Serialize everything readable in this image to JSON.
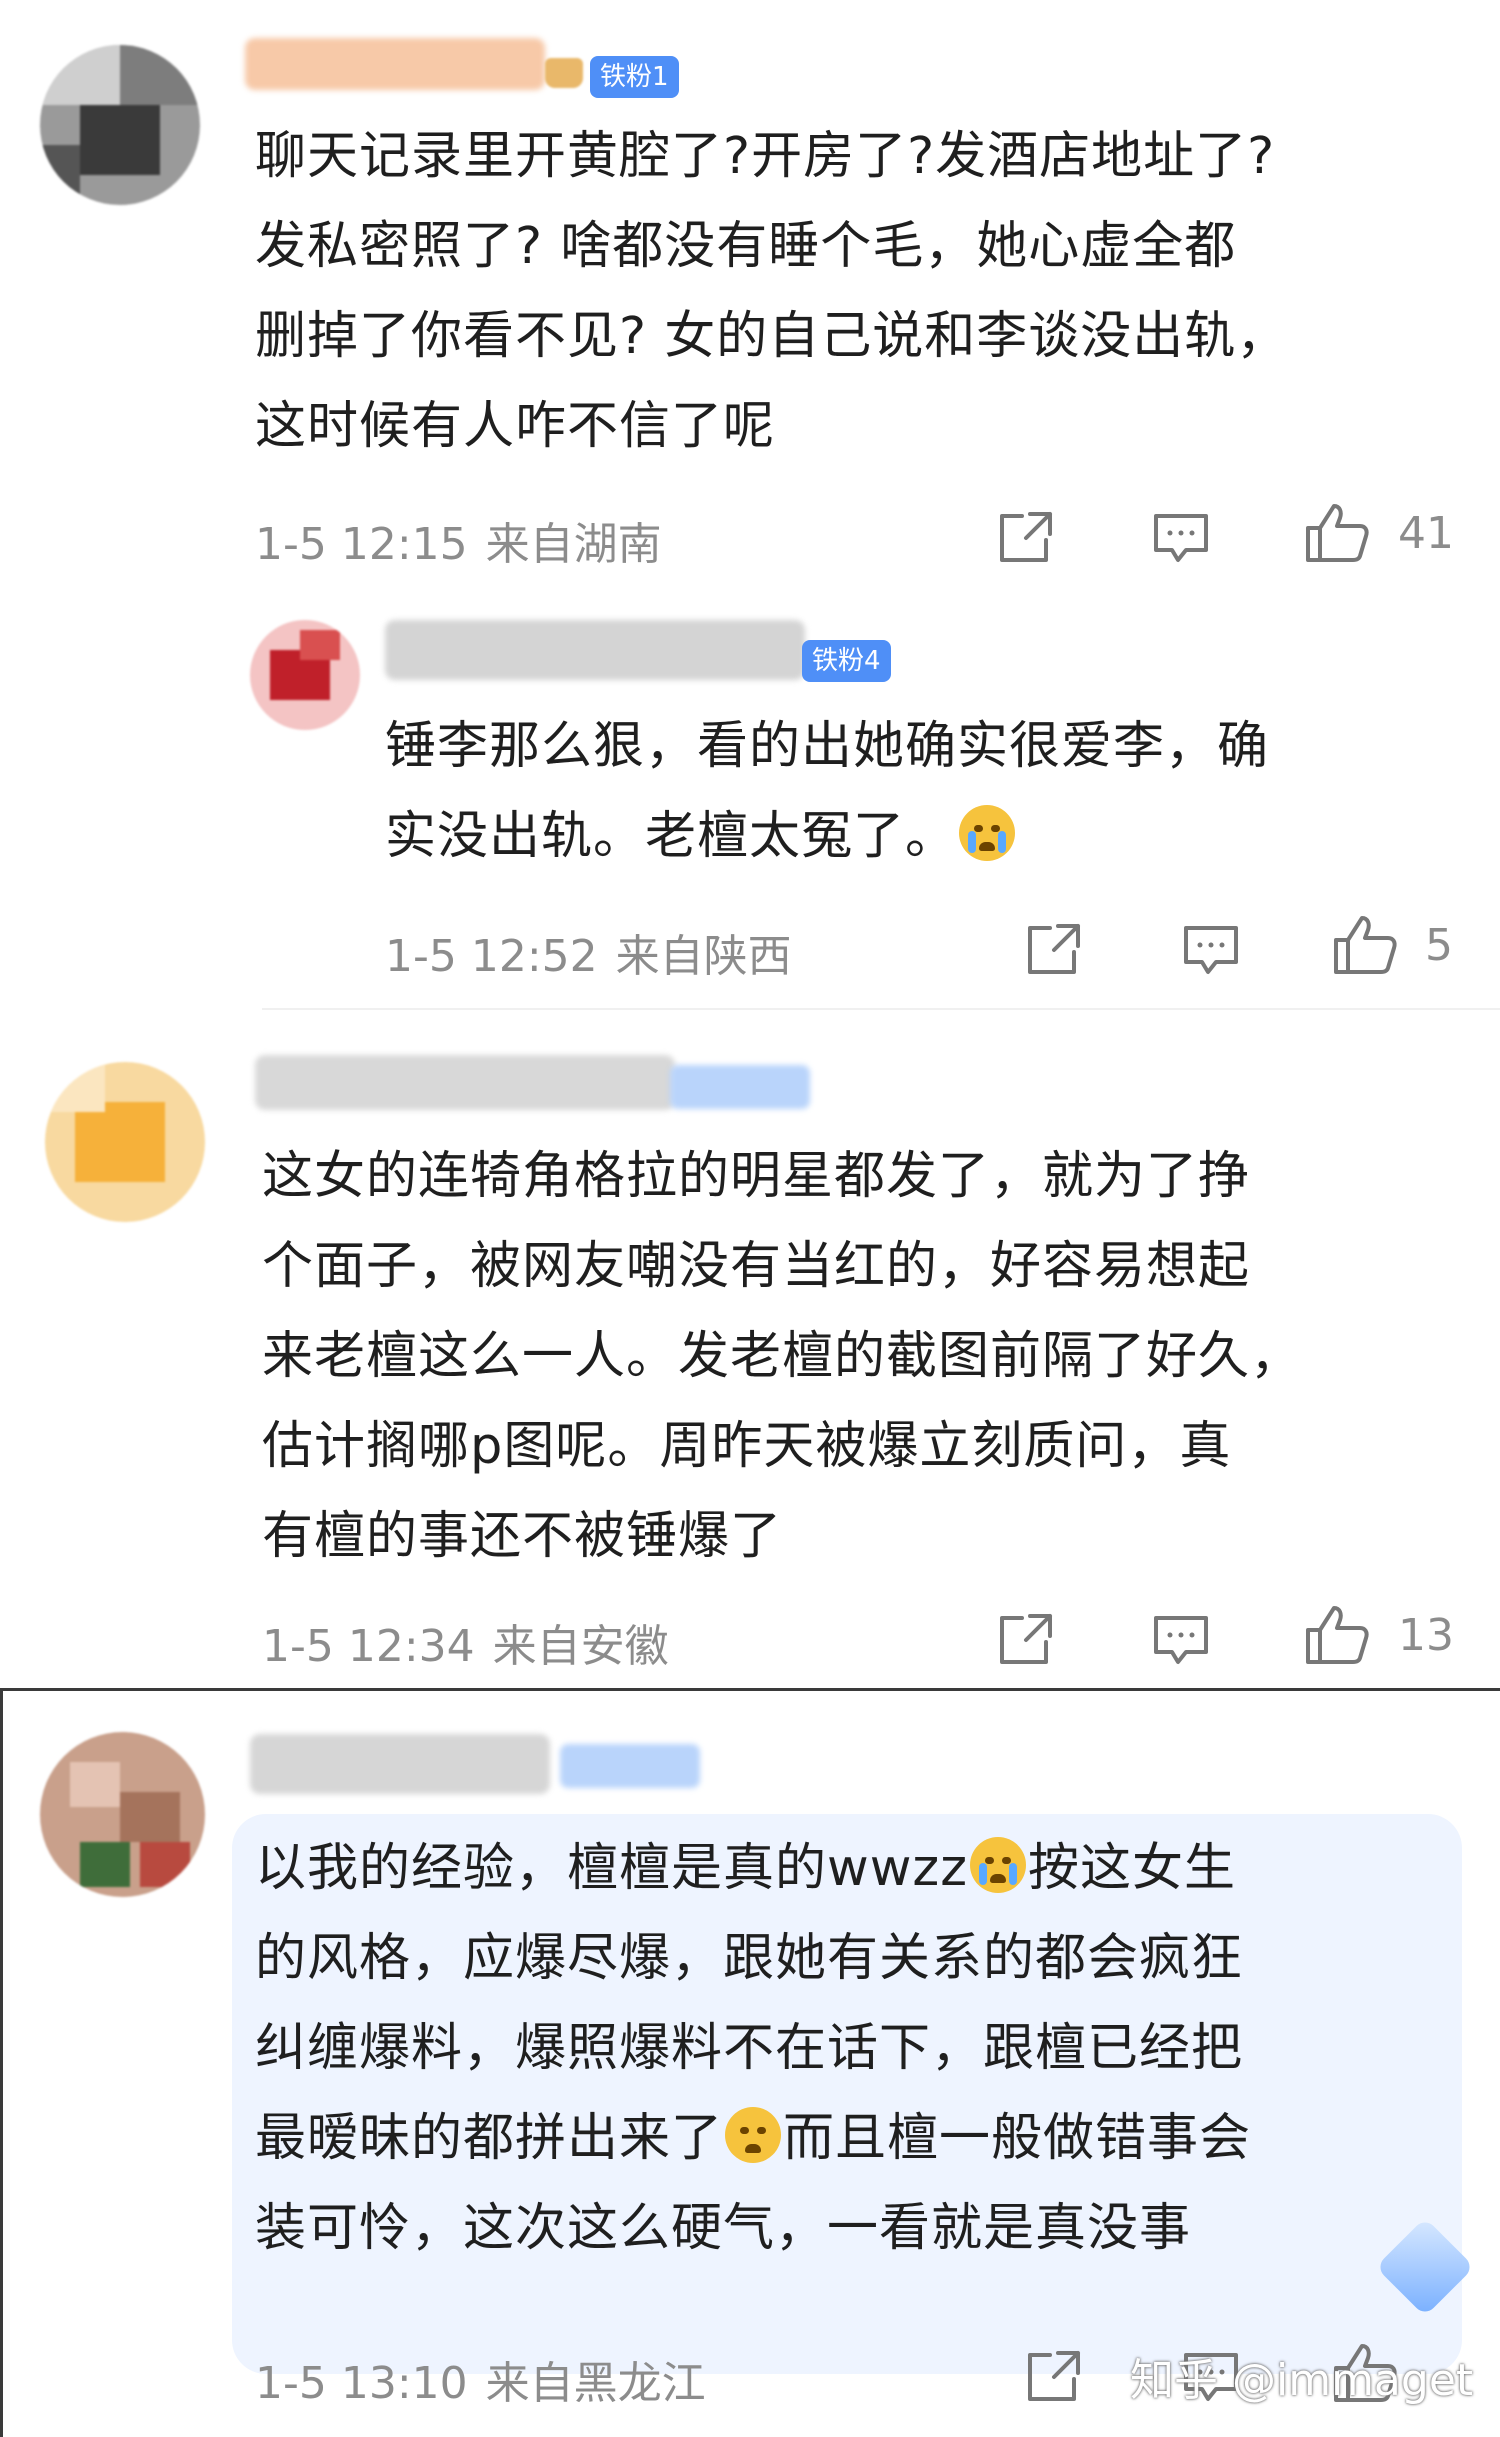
{
  "comments": [
    {
      "badge": "铁粉1",
      "lines": [
        "聊天记录里开黄腔了?开房了?发酒店地址了?",
        "发私密照了? 啥都没有睡个毛，她心虚全都",
        "删掉了你看不见? 女的自己说和李谈没出轨，",
        "这时候有人咋不信了呢"
      ],
      "time": "1-5 12:15",
      "location": "来自湖南",
      "likes": "41"
    },
    {
      "badge": "铁粉4",
      "lines": [
        "锤李那么狠，看的出她确实很爱李，确",
        "实没出轨。老檀太冤了。"
      ],
      "time": "1-5 12:52",
      "location": "来自陕西",
      "likes": "5"
    },
    {
      "lines": [
        "这女的连犄角格拉的明星都发了，就为了挣",
        "个面子，被网友嘲没有当红的，好容易想起",
        "来老檀这么一人。发老檀的截图前隔了好久，",
        "估计搁哪p图呢。周昨天被爆立刻质问，真",
        "有檀的事还不被锤爆了"
      ],
      "time": "1-5 12:34",
      "location": "来自安徽",
      "likes": "13"
    },
    {
      "lines_a": "以我的经验，檀檀是真的wwzz",
      "lines_b": "按这女生",
      "lines": [
        "的风格，应爆尽爆，跟她有关系的都会疯狂",
        "纠缠爆料，爆照爆料不在话下，跟檀已经把"
      ],
      "line5_a": "最暧昧的都拼出来了",
      "line5_b": "而且檀一般做错事会",
      "line6": "装可怜，这次这么硬气，一看就是真没事",
      "time": "1-5 13:10",
      "location": "来自黑龙江"
    }
  ],
  "watermark": "知乎 @immaget",
  "icons": {
    "share": "share-icon",
    "comment": "comment-icon",
    "like": "thumbs-up-icon",
    "cry_emoji": "crying-emoji-icon",
    "shush_emoji": "shushing-emoji-icon"
  },
  "colors": {
    "badge": "#4f8ff7",
    "meta_text": "#8c8c8c",
    "bubble": "#eef4ff"
  }
}
